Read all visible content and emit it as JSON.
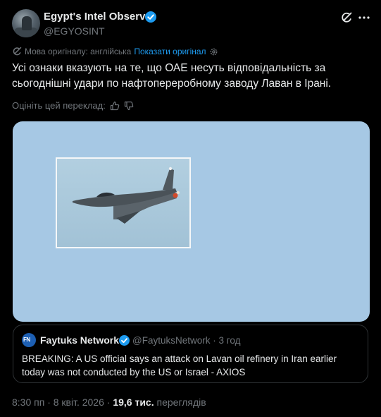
{
  "author": {
    "name": "Egypt's Intel Observer",
    "handle": "@EGYOSINT"
  },
  "translation": {
    "original_language_label": "Мова оригіналу: англійська",
    "show_original_link": "Показати оригінал",
    "rate_label": "Оцініть цей переклад:"
  },
  "post": {
    "text": "Усі ознаки вказують на те, що ОАЕ несуть відповідальність за сьогоднішні удари по нафтопереробному заводу Лаван в Ірані."
  },
  "quoted": {
    "avatar_text": "FN",
    "name": "Faytuks Network",
    "handle_time": "@FaytuksNetwork · 3 год",
    "text": "BREAKING: A US official says an attack on Lavan oil refinery in Iran earlier today was not conducted by the US or Israel - AXIOS"
  },
  "footer": {
    "time": "8:30 пп · 8 квіт. 2026 ·",
    "views_count": "19,6 тис.",
    "views_label": "переглядів"
  },
  "colors": {
    "accent": "#1d9bf0",
    "background": "#000000",
    "sky": "#a6c8e4"
  },
  "icons": [
    "verified-badge-icon",
    "grok-icon",
    "more-icon",
    "translate-icon",
    "gear-icon",
    "thumbs-up-icon",
    "thumbs-down-icon"
  ]
}
